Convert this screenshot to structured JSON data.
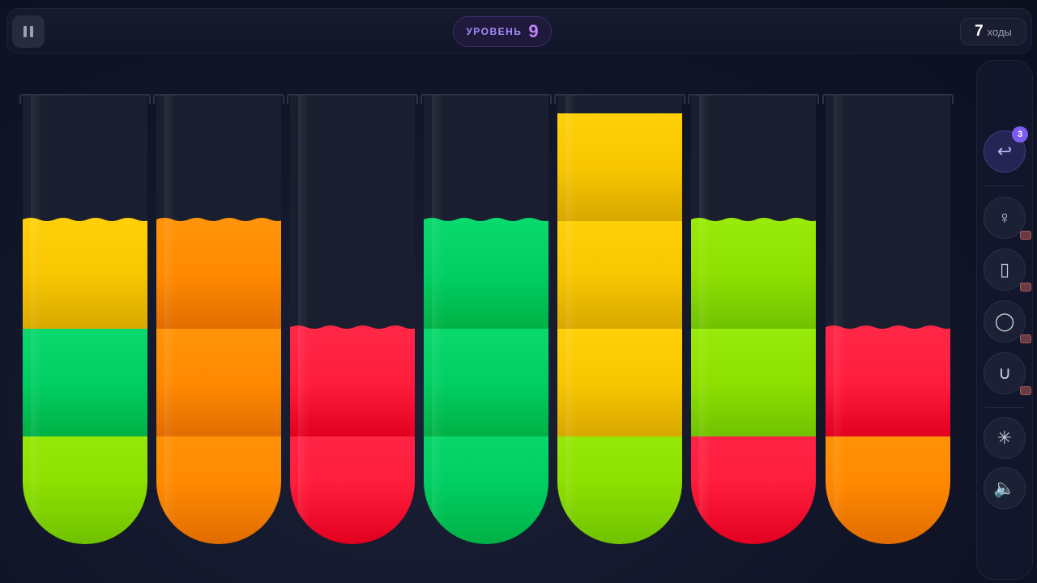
{
  "header": {
    "level_label": "УРОВЕНЬ",
    "level_number": "9",
    "moves_count": "7",
    "moves_label": "ходы"
  },
  "tools": [
    {
      "name": "undo",
      "icon": "undo-icon",
      "glyph": "↩",
      "badge": "3"
    },
    {
      "name": "hint",
      "icon": "bulb-icon",
      "glyph": "♀",
      "locked": true
    },
    {
      "name": "extra-tube",
      "icon": "tube-icon",
      "glyph": "▯",
      "locked": true
    },
    {
      "name": "bomb",
      "icon": "bomb-icon",
      "glyph": "◯",
      "locked": true
    },
    {
      "name": "magnet",
      "icon": "magnet-icon",
      "glyph": "∪",
      "locked": true
    },
    {
      "name": "freeze",
      "icon": "snowflake-icon",
      "glyph": "✳"
    },
    {
      "name": "sound",
      "icon": "speaker-icon",
      "glyph": "🔈"
    }
  ],
  "colors": {
    "yellow": "#f7c600",
    "green": "#00cf63",
    "lime": "#8ee000",
    "orange": "#ff8a00",
    "red": "#ff1d3d"
  },
  "tubes": [
    {
      "layers": [
        "lime",
        "green",
        "yellow"
      ],
      "capacity": 4
    },
    {
      "layers": [
        "orange",
        "orange",
        "orange"
      ],
      "capacity": 4
    },
    {
      "layers": [
        "red",
        "red"
      ],
      "capacity": 4
    },
    {
      "layers": [
        "green",
        "green",
        "green"
      ],
      "capacity": 4
    },
    {
      "layers": [
        "lime",
        "yellow",
        "yellow",
        "yellow"
      ],
      "capacity": 4
    },
    {
      "layers": [
        "red",
        "lime",
        "lime"
      ],
      "capacity": 4
    },
    {
      "layers": [
        "orange",
        "red"
      ],
      "capacity": 4
    }
  ]
}
